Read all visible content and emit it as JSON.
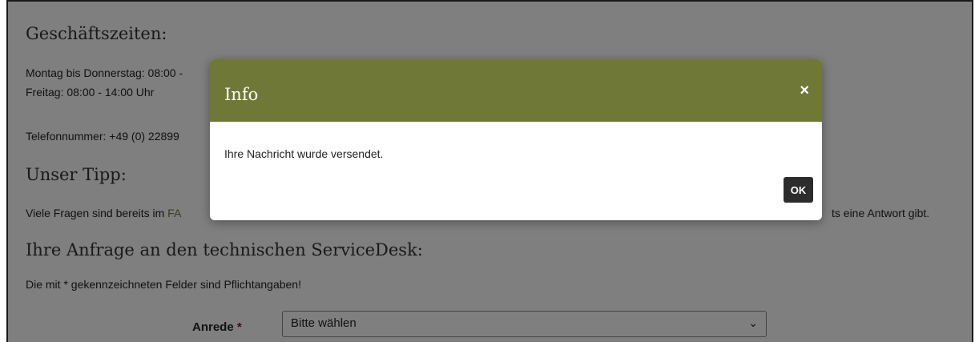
{
  "page": {
    "heading_hours": "Geschäftszeiten:",
    "hours_line1": "Montag bis Donnerstag: 08:00 -",
    "hours_line2": "Freitag: 08:00 - 14:00 Uhr",
    "phone": "Telefonnummer: +49 (0) 22899",
    "heading_tip": "Unser Tipp:",
    "tip_prefix": "Viele Fragen sind bereits im ",
    "tip_link": "FA",
    "tip_suffix": "ts eine Antwort gibt.",
    "heading_request": "Ihre Anfrage an den technischen ServiceDesk:",
    "required_note": "Die mit * gekennzeichneten Felder sind Pflichtangaben!"
  },
  "form": {
    "salutation_label": "Anrede",
    "required_marker": "*",
    "salutation_value": "Bitte wählen",
    "chevron": "⌄"
  },
  "modal": {
    "title": "Info",
    "close_symbol": "×",
    "message": "Ihre Nachricht wurde versendet.",
    "ok_label": "OK"
  },
  "colors": {
    "modal_header": "#6f7837",
    "ok_button": "#2c2c2c",
    "link": "#6e7a37"
  }
}
